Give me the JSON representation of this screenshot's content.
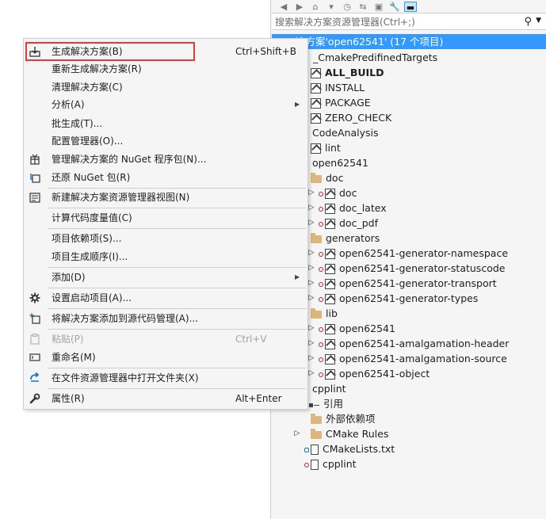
{
  "explorer": {
    "search_placeholder": "搜索解决方案资源管理器(Ctrl+;)",
    "solution_label": "决方案'open62541' (17 个项目)",
    "items": [
      {
        "label": "_CmakePredifinedTargets",
        "bold": false
      },
      {
        "label": "ALL_BUILD",
        "bold": true
      },
      {
        "label": "INSTALL",
        "bold": false
      },
      {
        "label": "PACKAGE",
        "bold": false
      },
      {
        "label": "ZERO_CHECK",
        "bold": false
      },
      {
        "label": "CodeAnalysis",
        "bold": false
      },
      {
        "label": "lint",
        "bold": false
      },
      {
        "label": "open62541",
        "bold": false
      },
      {
        "label": "doc",
        "bold": false
      },
      {
        "label": "doc",
        "bold": false
      },
      {
        "label": "doc_latex",
        "bold": false
      },
      {
        "label": "doc_pdf",
        "bold": false
      },
      {
        "label": "generators",
        "bold": false
      },
      {
        "label": "open62541-generator-namespace",
        "bold": false
      },
      {
        "label": "open62541-generator-statuscode",
        "bold": false
      },
      {
        "label": "open62541-generator-transport",
        "bold": false
      },
      {
        "label": "open62541-generator-types",
        "bold": false
      },
      {
        "label": "lib",
        "bold": false
      },
      {
        "label": "open62541",
        "bold": false
      },
      {
        "label": "open62541-amalgamation-header",
        "bold": false
      },
      {
        "label": "open62541-amalgamation-source",
        "bold": false
      },
      {
        "label": "open62541-object",
        "bold": false
      },
      {
        "label": "cpplint",
        "bold": false
      },
      {
        "label": "引用",
        "bold": false
      },
      {
        "label": "外部依赖项",
        "bold": false
      },
      {
        "label": "CMake Rules",
        "bold": false
      },
      {
        "label": "CMakeLists.txt",
        "bold": false
      },
      {
        "label": "cpplint",
        "bold": false
      }
    ]
  },
  "menu": {
    "items": [
      {
        "label": "生成解决方案(B)",
        "shortcut": "Ctrl+Shift+B"
      },
      {
        "label": "重新生成解决方案(R)"
      },
      {
        "label": "清理解决方案(C)"
      },
      {
        "label": "分析(A)"
      },
      {
        "label": "批生成(T)..."
      },
      {
        "label": "配置管理器(O)..."
      },
      {
        "label": "管理解决方案的 NuGet 程序包(N)..."
      },
      {
        "label": "还原 NuGet 包(R)"
      },
      {
        "label": "新建解决方案资源管理器视图(N)"
      },
      {
        "label": "计算代码度量值(C)"
      },
      {
        "label": "项目依赖项(S)..."
      },
      {
        "label": "项目生成顺序(I)..."
      },
      {
        "label": "添加(D)"
      },
      {
        "label": "设置启动项目(A)..."
      },
      {
        "label": "将解决方案添加到源代码管理(A)..."
      },
      {
        "label": "粘贴(P)",
        "shortcut": "Ctrl+V"
      },
      {
        "label": "重命名(M)"
      },
      {
        "label": "在文件资源管理器中打开文件夹(X)"
      },
      {
        "label": "属性(R)",
        "shortcut": "Alt+Enter"
      }
    ]
  },
  "colors": {
    "selection": "#3399ff",
    "highlight_box": "#e8383b",
    "menu_bg": "#f5f5f5"
  }
}
